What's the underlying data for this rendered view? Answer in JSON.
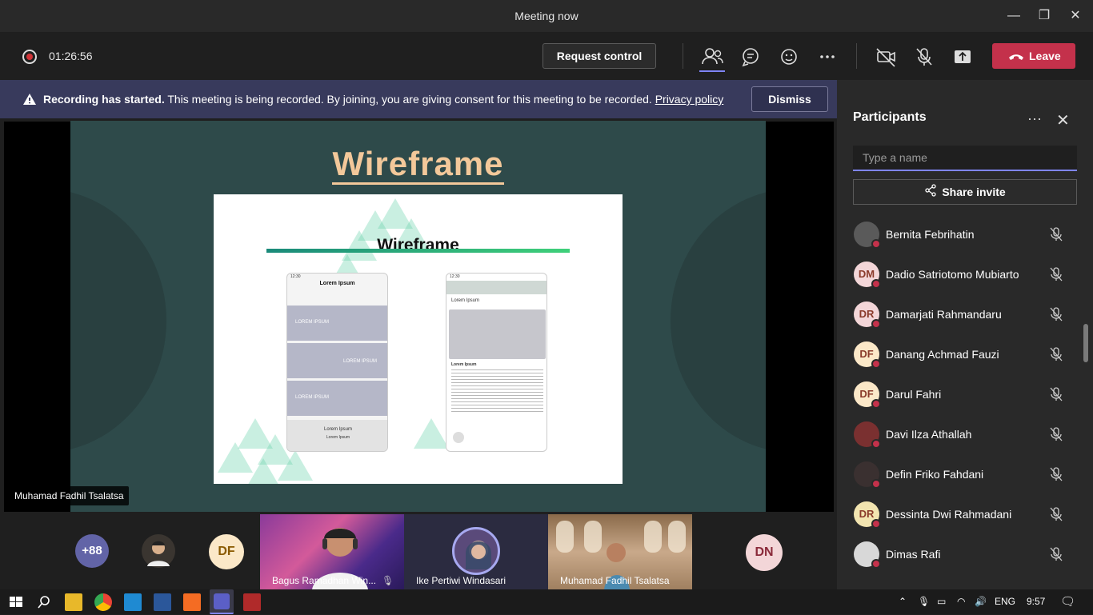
{
  "window": {
    "title": "Meeting now",
    "min": "—",
    "max": "❐",
    "close": "✕"
  },
  "toolbar": {
    "timer": "01:26:56",
    "request_control": "Request control",
    "leave": "Leave",
    "icons": [
      "participants-icon",
      "chat-icon",
      "reactions-icon",
      "more-icon",
      "camera-off-icon",
      "mic-off-icon",
      "share-tray-icon"
    ]
  },
  "banner": {
    "bold": "Recording has started.",
    "text": " This meeting is being recorded. By joining, you are giving consent for this meeting to be recorded. ",
    "link": "Privacy policy",
    "dismiss": "Dismiss"
  },
  "slide": {
    "heading": "Wireframe",
    "inner_title": "Wireframe",
    "phone1": {
      "time": "12:30",
      "header": "Lorem Ipsum",
      "blocks": [
        "LOREM IPSUM",
        "LOREM IPSUM",
        "LOREM IPSUM"
      ],
      "footer_title": "Lorem Ipsum",
      "footer_sub": "Lorem Ipsum"
    },
    "phone2": {
      "time": "12:30",
      "label": "Lorem Ipsum",
      "content_title": "Lorem Ipsum"
    }
  },
  "speaker_tag": "Muhamad Fadhil Tsalatsa",
  "strip": {
    "overflow": "+88",
    "tiles": [
      {
        "initials": "DF"
      },
      {
        "name": "Bagus Ramadhan Win..."
      },
      {
        "name": "Ike Pertiwi Windasari"
      },
      {
        "name": "Muhamad Fadhil Tsalatsa"
      },
      {
        "initials": "DN"
      }
    ]
  },
  "panel": {
    "title": "Participants",
    "more": "···",
    "close": "✕",
    "search_placeholder": "Type a name",
    "share_invite": "Share invite",
    "participants": [
      {
        "name": "Bernita Febrihatin",
        "initials": "",
        "color": "#5a5a5a"
      },
      {
        "name": "Dadio Satriotomo Mubiarto",
        "initials": "DM",
        "color": "#f3d6d8"
      },
      {
        "name": "Damarjati Rahmandaru",
        "initials": "DR",
        "color": "#f3d6d8"
      },
      {
        "name": "Danang Achmad Fauzi",
        "initials": "DF",
        "color": "#fbe8c8"
      },
      {
        "name": "Darul Fahri",
        "initials": "DF",
        "color": "#fbe8c8"
      },
      {
        "name": "Davi Ilza Athallah",
        "initials": "",
        "color": "#7a3030"
      },
      {
        "name": "Defin Friko Fahdani",
        "initials": "",
        "color": "#3a3030"
      },
      {
        "name": "Dessinta Dwi Rahmadani",
        "initials": "DR",
        "color": "#f2e4b0"
      },
      {
        "name": "Dimas Rafi",
        "initials": "",
        "color": "#d8d8d8"
      }
    ]
  },
  "taskbar": {
    "lang": "ENG",
    "time": "9:57"
  }
}
